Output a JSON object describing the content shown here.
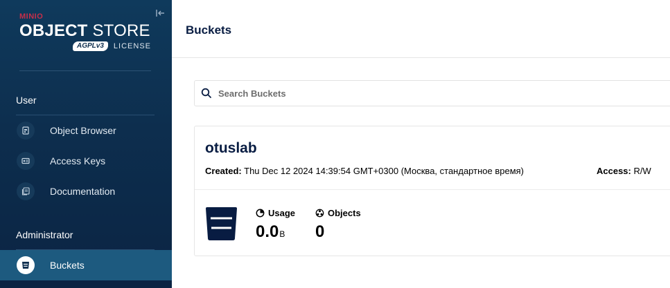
{
  "sidebar": {
    "brand": {
      "company": "MINIO",
      "title_bold": "OBJECT",
      "title_light": "STORE",
      "license_badge": "AGPLv3",
      "license_text": "LICENSE"
    },
    "sections": [
      {
        "title": "User",
        "items": [
          {
            "label": "Object Browser",
            "icon": "object-browser-icon"
          },
          {
            "label": "Access Keys",
            "icon": "access-keys-icon"
          },
          {
            "label": "Documentation",
            "icon": "documentation-icon"
          }
        ]
      },
      {
        "title": "Administrator",
        "items": [
          {
            "label": "Buckets",
            "icon": "bucket-icon",
            "active": true
          }
        ]
      }
    ],
    "collapse_icon": "collapse-sidebar-icon"
  },
  "header": {
    "title": "Buckets"
  },
  "search": {
    "placeholder": "Search Buckets",
    "value": ""
  },
  "buckets": [
    {
      "name": "otuslab",
      "created_label": "Created:",
      "created_value": "Thu Dec 12 2024 14:39:54 GMT+0300 (Москва, стандартное время)",
      "access_label": "Access:",
      "access_value": "R/W",
      "usage_label": "Usage",
      "usage_value": "0.0",
      "usage_unit": "B",
      "objects_label": "Objects",
      "objects_value": "0"
    }
  ],
  "colors": {
    "sidebar_bg": "#0d2e4e",
    "active_item": "#1d5a7f",
    "brand_red": "#c72e49",
    "title_navy": "#081c42"
  }
}
